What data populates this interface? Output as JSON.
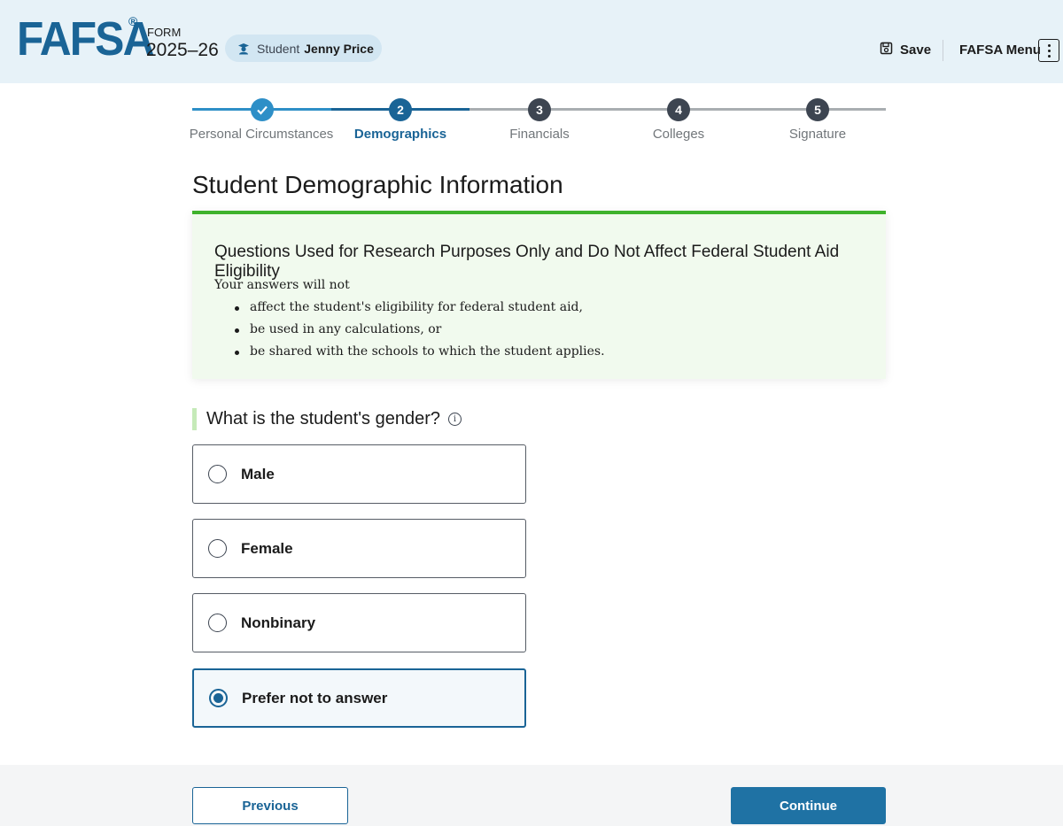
{
  "header": {
    "logo": "FAFSA",
    "logo_mark": "®",
    "form_label": "FORM",
    "form_year": "2025–26",
    "student_prefix": "Student",
    "student_name": "Jenny Price",
    "save_label": "Save",
    "menu_label": "FAFSA Menu"
  },
  "stepper": {
    "steps": [
      {
        "number": "",
        "label": "Personal Circumstances",
        "status": "complete"
      },
      {
        "number": "2",
        "label": "Demographics",
        "status": "current"
      },
      {
        "number": "3",
        "label": "Financials",
        "status": "upcoming"
      },
      {
        "number": "4",
        "label": "Colleges",
        "status": "upcoming"
      },
      {
        "number": "5",
        "label": "Signature",
        "status": "upcoming"
      }
    ]
  },
  "page_title": "Student Demographic Information",
  "info_box": {
    "title": "Questions Used for Research Purposes Only and Do Not Affect Federal Student Aid Eligibility",
    "intro": "Your answers will not",
    "bullets": [
      "affect the student's eligibility for federal student aid,",
      "be used in any calculations, or",
      "be shared with the schools to which the student applies."
    ]
  },
  "question": {
    "text": "What is the student's gender?",
    "info_glyph": "i",
    "options": [
      {
        "label": "Male",
        "selected": false
      },
      {
        "label": "Female",
        "selected": false
      },
      {
        "label": "Nonbinary",
        "selected": false
      },
      {
        "label": "Prefer not to answer",
        "selected": true
      }
    ]
  },
  "footer": {
    "previous_label": "Previous",
    "continue_label": "Continue"
  },
  "colors": {
    "brand": "#1a6496",
    "header_bg": "#e7f2f8",
    "success_green": "#3fb22c",
    "complete_blue": "#2e8fc7",
    "upcoming_gray": "#565c65"
  }
}
